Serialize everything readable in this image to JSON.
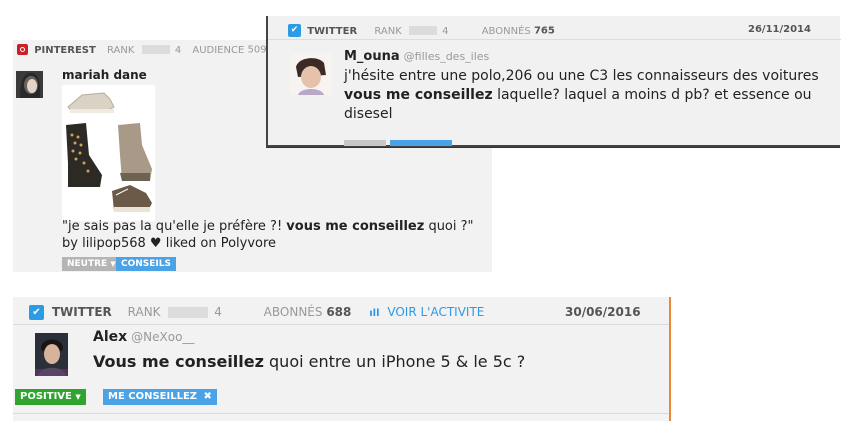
{
  "pinterest": {
    "network": "PINTEREST",
    "rank_label": "RANK",
    "rank_value": "4",
    "audience_label": "AUDIENCE",
    "audience_value": "509",
    "author": "mariah dane",
    "text_before": "\"je sais pas la qu'elle je préfère ?! ",
    "text_bold": "vous me conseillez",
    "text_after": " quoi ?\" by lilipop568 ♥ liked on Polyvore",
    "sentiment": "NEUTRE",
    "tag": "CONSEILS",
    "icon": "pinterest-icon"
  },
  "tweet1": {
    "network": "TWITTER",
    "rank_label": "RANK",
    "rank_value": "4",
    "followers_label": "ABONNÉS",
    "followers_value": "765",
    "date": "26/11/2014",
    "author": "M_ouna",
    "handle": "@filles_des_iles",
    "text_before": "j'hésite entre une polo,206 ou une C3 les connaisseurs des voitures ",
    "text_bold": "vous me conseillez",
    "text_after": " laquelle? laquel a moins d pb? et essence ou disesel",
    "icon": "twitter-icon"
  },
  "tweet2": {
    "network": "TWITTER",
    "rank_label": "RANK",
    "rank_value": "4",
    "followers_label": "ABONNÉS",
    "followers_value": "688",
    "activity_link": "VOIR L'ACTIVITE",
    "date": "30/06/2016",
    "author": "Alex",
    "handle": "@NeXoo__",
    "text_bold": "Vous me conseillez",
    "text_after": " quoi entre un iPhone 5 & le 5c ?",
    "sentiment": "POSITIVE",
    "tag": "ME CONSEILLEZ",
    "icon": "twitter-icon"
  },
  "colors": {
    "twitter": "#2b9be6",
    "pinterest": "#cb2027",
    "positive": "#2fa52f",
    "neutral": "#b5b5b5",
    "tag": "#4aa3e6",
    "activity": "#2b9be6"
  }
}
